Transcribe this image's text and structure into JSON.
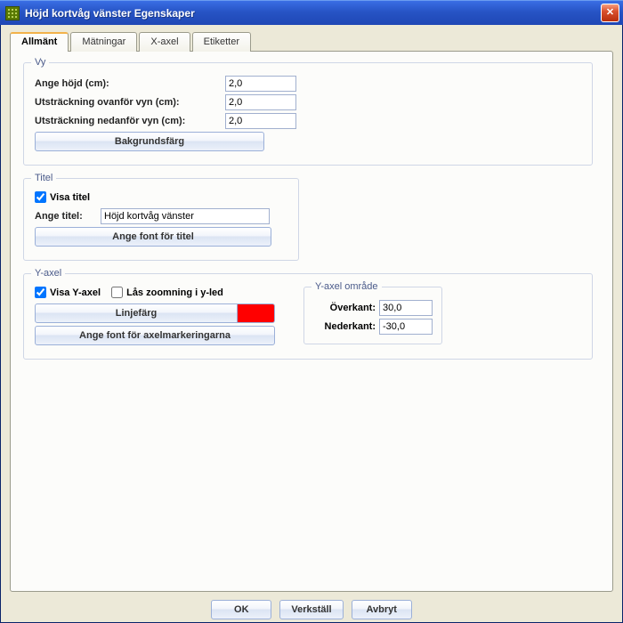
{
  "window": {
    "title": "Höjd kortvåg vänster Egenskaper"
  },
  "tabs": [
    "Allmänt",
    "Mätningar",
    "X-axel",
    "Etiketter"
  ],
  "active_tab": 0,
  "vy": {
    "legend": "Vy",
    "height_label": "Ange höjd (cm):",
    "height_value": "2,0",
    "extent_above_label": "Utsträckning ovanför vyn (cm):",
    "extent_above_value": "2,0",
    "extent_below_label": "Utsträckning nedanför vyn (cm):",
    "extent_below_value": "2,0",
    "bgcolor_button": "Bakgrundsfärg"
  },
  "titel": {
    "legend": "Titel",
    "show_title_label": "Visa titel",
    "show_title_checked": true,
    "title_label": "Ange titel:",
    "title_value": "Höjd kortvåg vänster",
    "font_button": "Ange font för titel"
  },
  "yaxis": {
    "legend": "Y-axel",
    "show_label": "Visa Y-axel",
    "show_checked": true,
    "lock_zoom_label": "Lås zoomning i y-led",
    "lock_zoom_checked": false,
    "linecolor_button": "Linjefärg",
    "linecolor": "#ff0000",
    "font_button": "Ange font för axelmarkeringarna",
    "range": {
      "legend": "Y-axel område",
      "top_label": "Överkant:",
      "top_value": "30,0",
      "bottom_label": "Nederkant:",
      "bottom_value": "-30,0"
    }
  },
  "buttons": {
    "ok": "OK",
    "apply": "Verkställ",
    "cancel": "Avbryt"
  }
}
